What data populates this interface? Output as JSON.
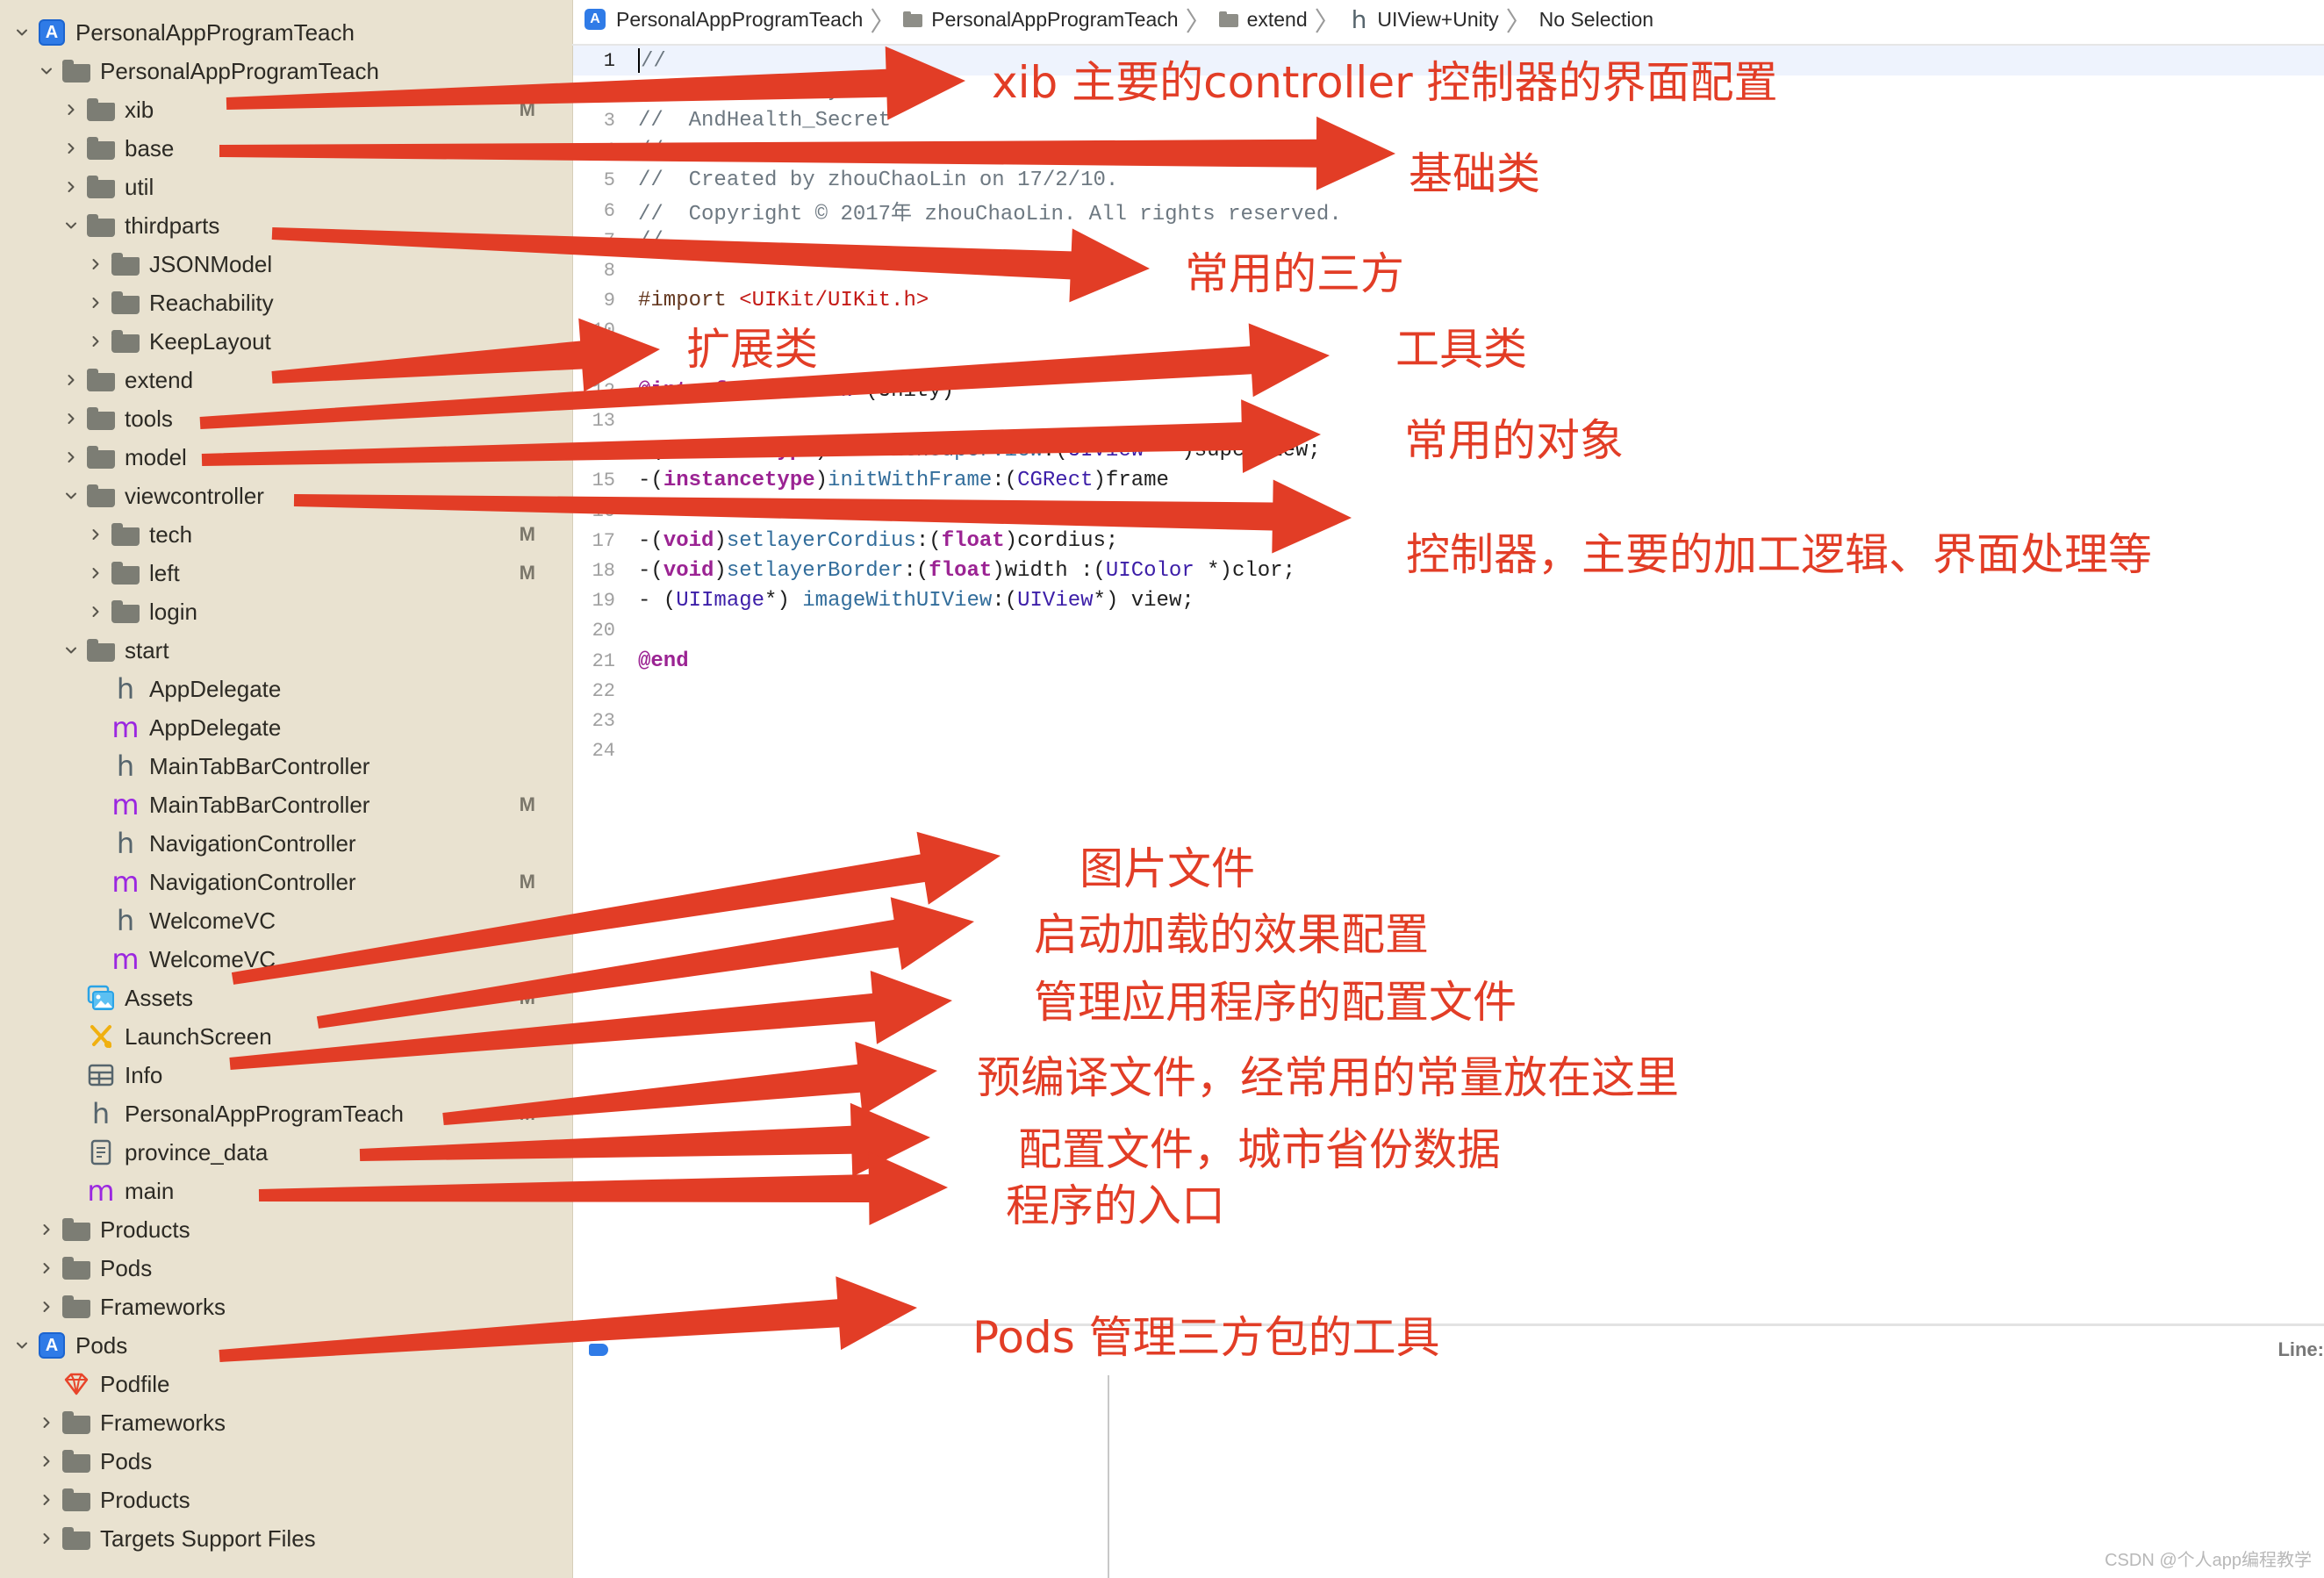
{
  "navigator": {
    "rows": [
      {
        "label": "PersonalAppProgramTeach",
        "icon": "xcode-project-icon",
        "depth": 0,
        "disclosure": "expanded",
        "badge": ""
      },
      {
        "label": "PersonalAppProgramTeach",
        "icon": "folder-icon",
        "depth": 1,
        "disclosure": "expanded",
        "badge": ""
      },
      {
        "label": "xib",
        "icon": "folder-icon",
        "depth": 2,
        "disclosure": "collapsed",
        "badge": "M"
      },
      {
        "label": "base",
        "icon": "folder-icon",
        "depth": 2,
        "disclosure": "collapsed",
        "badge": ""
      },
      {
        "label": "util",
        "icon": "folder-icon",
        "depth": 2,
        "disclosure": "collapsed",
        "badge": ""
      },
      {
        "label": "thirdparts",
        "icon": "folder-icon",
        "depth": 2,
        "disclosure": "expanded",
        "badge": ""
      },
      {
        "label": "JSONModel",
        "icon": "folder-icon",
        "depth": 3,
        "disclosure": "collapsed",
        "badge": ""
      },
      {
        "label": "Reachability",
        "icon": "folder-icon",
        "depth": 3,
        "disclosure": "collapsed",
        "badge": ""
      },
      {
        "label": "KeepLayout",
        "icon": "folder-icon",
        "depth": 3,
        "disclosure": "collapsed",
        "badge": ""
      },
      {
        "label": "extend",
        "icon": "folder-icon",
        "depth": 2,
        "disclosure": "collapsed",
        "badge": ""
      },
      {
        "label": "tools",
        "icon": "folder-icon",
        "depth": 2,
        "disclosure": "collapsed",
        "badge": ""
      },
      {
        "label": "model",
        "icon": "folder-icon",
        "depth": 2,
        "disclosure": "collapsed",
        "badge": ""
      },
      {
        "label": "viewcontroller",
        "icon": "folder-icon",
        "depth": 2,
        "disclosure": "expanded",
        "badge": ""
      },
      {
        "label": "tech",
        "icon": "folder-icon",
        "depth": 3,
        "disclosure": "collapsed",
        "badge": "M"
      },
      {
        "label": "left",
        "icon": "folder-icon",
        "depth": 3,
        "disclosure": "collapsed",
        "badge": "M"
      },
      {
        "label": "login",
        "icon": "folder-icon",
        "depth": 3,
        "disclosure": "collapsed",
        "badge": ""
      },
      {
        "label": "start",
        "icon": "folder-icon",
        "depth": 2,
        "disclosure": "expanded",
        "badge": ""
      },
      {
        "label": "AppDelegate",
        "icon": "header-file-icon",
        "depth": 3,
        "disclosure": "none",
        "badge": ""
      },
      {
        "label": "AppDelegate",
        "icon": "objc-file-icon",
        "depth": 3,
        "disclosure": "none",
        "badge": ""
      },
      {
        "label": "MainTabBarController",
        "icon": "header-file-icon",
        "depth": 3,
        "disclosure": "none",
        "badge": ""
      },
      {
        "label": "MainTabBarController",
        "icon": "objc-file-icon",
        "depth": 3,
        "disclosure": "none",
        "badge": "M"
      },
      {
        "label": "NavigationController",
        "icon": "header-file-icon",
        "depth": 3,
        "disclosure": "none",
        "badge": ""
      },
      {
        "label": "NavigationController",
        "icon": "objc-file-icon",
        "depth": 3,
        "disclosure": "none",
        "badge": "M"
      },
      {
        "label": "WelcomeVC",
        "icon": "header-file-icon",
        "depth": 3,
        "disclosure": "none",
        "badge": ""
      },
      {
        "label": "WelcomeVC",
        "icon": "objc-file-icon",
        "depth": 3,
        "disclosure": "none",
        "badge": ""
      },
      {
        "label": "Assets",
        "icon": "asset-catalog-icon",
        "depth": 2,
        "disclosure": "none",
        "badge": "M"
      },
      {
        "label": "LaunchScreen",
        "icon": "storyboard-icon",
        "depth": 2,
        "disclosure": "none",
        "badge": ""
      },
      {
        "label": "Info",
        "icon": "plist-icon",
        "depth": 2,
        "disclosure": "none",
        "badge": ""
      },
      {
        "label": "PersonalAppProgramTeach",
        "icon": "header-file-icon",
        "depth": 2,
        "disclosure": "none",
        "badge": "M"
      },
      {
        "label": "province_data",
        "icon": "document-icon",
        "depth": 2,
        "disclosure": "none",
        "badge": ""
      },
      {
        "label": "main",
        "icon": "objc-file-icon",
        "depth": 2,
        "disclosure": "none",
        "badge": ""
      },
      {
        "label": "Products",
        "icon": "folder-icon",
        "depth": 1,
        "disclosure": "collapsed",
        "badge": ""
      },
      {
        "label": "Pods",
        "icon": "folder-icon",
        "depth": 1,
        "disclosure": "collapsed",
        "badge": ""
      },
      {
        "label": "Frameworks",
        "icon": "folder-icon",
        "depth": 1,
        "disclosure": "collapsed",
        "badge": ""
      },
      {
        "label": "Pods",
        "icon": "xcode-project-icon",
        "depth": 0,
        "disclosure": "expanded",
        "badge": ""
      },
      {
        "label": "Podfile",
        "icon": "ruby-gem-icon",
        "depth": 1,
        "disclosure": "none",
        "badge": ""
      },
      {
        "label": "Frameworks",
        "icon": "folder-icon",
        "depth": 1,
        "disclosure": "collapsed",
        "badge": ""
      },
      {
        "label": "Pods",
        "icon": "folder-icon",
        "depth": 1,
        "disclosure": "collapsed",
        "badge": ""
      },
      {
        "label": "Products",
        "icon": "folder-icon",
        "depth": 1,
        "disclosure": "collapsed",
        "badge": ""
      },
      {
        "label": "Targets Support Files",
        "icon": "folder-icon",
        "depth": 1,
        "disclosure": "collapsed",
        "badge": ""
      }
    ]
  },
  "breadcrumb": {
    "items": [
      {
        "label": "PersonalAppProgramTeach",
        "icon": "xcode-project-icon"
      },
      {
        "label": "PersonalAppProgramTeach",
        "icon": "folder-icon"
      },
      {
        "label": "extend",
        "icon": "folder-icon"
      },
      {
        "label": "UIView+Unity",
        "icon": "header-file-icon"
      },
      {
        "label": "No Selection",
        "icon": ""
      }
    ]
  },
  "editor": {
    "current_line": 1,
    "lines": [
      {
        "n": "1",
        "tokens": [
          [
            "comment",
            "//"
          ]
        ]
      },
      {
        "n": "2",
        "tokens": [
          [
            "comment",
            "//  UIView+Unity.h"
          ]
        ]
      },
      {
        "n": "3",
        "tokens": [
          [
            "comment",
            "//  AndHealth_Secret"
          ]
        ]
      },
      {
        "n": "4",
        "tokens": [
          [
            "comment",
            "//"
          ]
        ]
      },
      {
        "n": "5",
        "tokens": [
          [
            "comment",
            "//  Created by zhouChaoLin on 17/2/10."
          ]
        ]
      },
      {
        "n": "6",
        "tokens": [
          [
            "comment",
            "//  Copyright © 2017年 zhouChaoLin. All rights reserved."
          ]
        ]
      },
      {
        "n": "7",
        "tokens": [
          [
            "comment",
            "//"
          ]
        ]
      },
      {
        "n": "8",
        "tokens": []
      },
      {
        "n": "9",
        "tokens": [
          [
            "preproc",
            "#import "
          ],
          [
            "string",
            "<UIKit/UIKit.h>"
          ]
        ]
      },
      {
        "n": "10",
        "tokens": []
      },
      {
        "n": "11",
        "tokens": []
      },
      {
        "n": "12",
        "tokens": [
          [
            "kw",
            "@interface "
          ],
          [
            "type",
            "UIView"
          ],
          [
            "plain",
            " (Unity)"
          ]
        ]
      },
      {
        "n": "13",
        "tokens": []
      },
      {
        "n": "14",
        "tokens": [
          [
            "plain",
            "-("
          ],
          [
            "kw",
            "instancetype"
          ],
          [
            "plain",
            ")"
          ],
          [
            "method",
            "initWithSuperView"
          ],
          [
            "plain",
            ":("
          ],
          [
            "type",
            "UIView"
          ],
          [
            "plain",
            "  *)superView;"
          ]
        ]
      },
      {
        "n": "15",
        "tokens": [
          [
            "plain",
            "-("
          ],
          [
            "kw",
            "instancetype"
          ],
          [
            "plain",
            ")"
          ],
          [
            "method",
            "initWithFrame"
          ],
          [
            "plain",
            ":("
          ],
          [
            "type",
            "CGRect"
          ],
          [
            "plain",
            ")frame"
          ]
        ]
      },
      {
        "n": "16",
        "tokens": []
      },
      {
        "n": "17",
        "tokens": [
          [
            "plain",
            "-("
          ],
          [
            "kw",
            "void"
          ],
          [
            "plain",
            ")"
          ],
          [
            "method",
            "setlayerCordius"
          ],
          [
            "plain",
            ":("
          ],
          [
            "kw",
            "float"
          ],
          [
            "plain",
            ")cordius;"
          ]
        ]
      },
      {
        "n": "18",
        "tokens": [
          [
            "plain",
            "-("
          ],
          [
            "kw",
            "void"
          ],
          [
            "plain",
            ")"
          ],
          [
            "method",
            "setlayerBorder"
          ],
          [
            "plain",
            ":("
          ],
          [
            "kw",
            "float"
          ],
          [
            "plain",
            ")width :("
          ],
          [
            "type",
            "UIColor"
          ],
          [
            "plain",
            " *)clor;"
          ]
        ]
      },
      {
        "n": "19",
        "tokens": [
          [
            "plain",
            "- ("
          ],
          [
            "type",
            "UIImage"
          ],
          [
            "plain",
            "*) "
          ],
          [
            "method",
            "imageWithUIView"
          ],
          [
            "plain",
            ":("
          ],
          [
            "type",
            "UIView"
          ],
          [
            "plain",
            "*) view;"
          ]
        ]
      },
      {
        "n": "20",
        "tokens": []
      },
      {
        "n": "21",
        "tokens": [
          [
            "kw",
            "@end"
          ]
        ]
      },
      {
        "n": "22",
        "tokens": []
      },
      {
        "n": "23",
        "tokens": []
      },
      {
        "n": "24",
        "tokens": []
      }
    ]
  },
  "bottombar": {
    "line_label": "Line:"
  },
  "watermark": "CSDN @个人app编程教学",
  "annotations": {
    "color": "#e23d26",
    "notes": [
      {
        "text": "xib 主要的controller 控制器的界面配置",
        "target": "xib"
      },
      {
        "text": "基础类",
        "target": "base"
      },
      {
        "text": "常用的三方",
        "target": "thirdparts"
      },
      {
        "text": "扩展类",
        "target": "extend"
      },
      {
        "text": "工具类",
        "target": "tools"
      },
      {
        "text": "常用的对象",
        "target": "model"
      },
      {
        "text": "控制器，主要的加工逻辑、界面处理等",
        "target": "viewcontroller"
      },
      {
        "text": "图片文件",
        "target": "Assets"
      },
      {
        "text": "启动加载的效果配置",
        "target": "LaunchScreen"
      },
      {
        "text": "管理应用程序的配置文件",
        "target": "Info"
      },
      {
        "text": "预编译文件，经常用的常量放在这里",
        "target": "PersonalAppProgramTeach.h"
      },
      {
        "text": "配置文件，城市省份数据",
        "target": "province_data"
      },
      {
        "text": "程序的入口",
        "target": "main"
      },
      {
        "text": "Pods 管理三方包的工具",
        "target": "Pods"
      }
    ]
  }
}
